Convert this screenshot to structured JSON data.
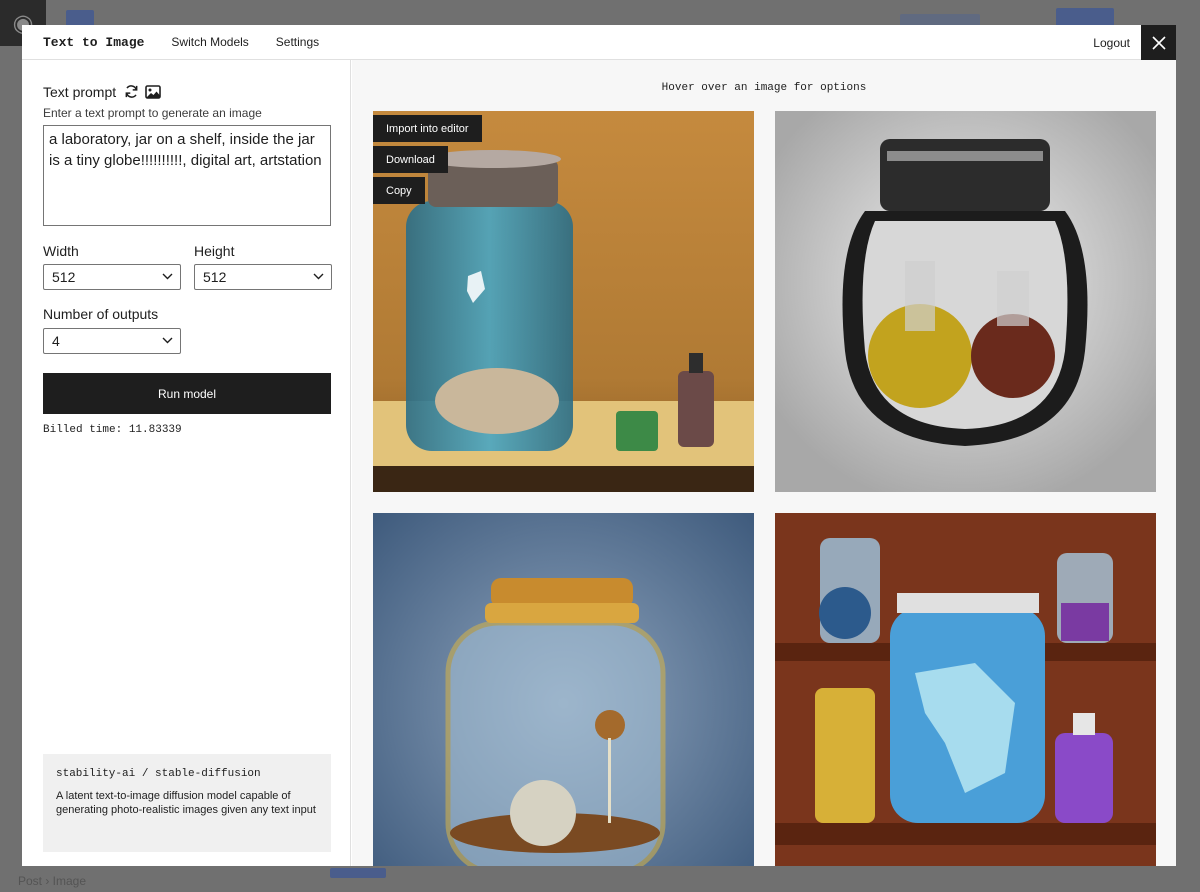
{
  "modal": {
    "title": "Text to Image",
    "nav": [
      {
        "label": "Switch Models"
      },
      {
        "label": "Settings"
      }
    ],
    "logout_label": "Logout"
  },
  "sidebar": {
    "prompt_label": "Text prompt",
    "prompt_helper": "Enter a text prompt to generate an image",
    "prompt_value": "a laboratory, jar on a shelf, inside the jar is a tiny globe!!!!!!!!!!, digital art, artstation",
    "width_label": "Width",
    "width_value": "512",
    "height_label": "Height",
    "height_value": "512",
    "outputs_label": "Number of outputs",
    "outputs_value": "4",
    "run_label": "Run model",
    "billed_text": "Billed time: 11.83339",
    "model_name": "stability-ai / stable-diffusion",
    "model_description": "A latent text-to-image diffusion model capable of generating photo-realistic images given any text input"
  },
  "main": {
    "hint": "Hover over an image for options",
    "overlay": {
      "import_label": "Import into editor",
      "download_label": "Download",
      "copy_label": "Copy"
    }
  }
}
